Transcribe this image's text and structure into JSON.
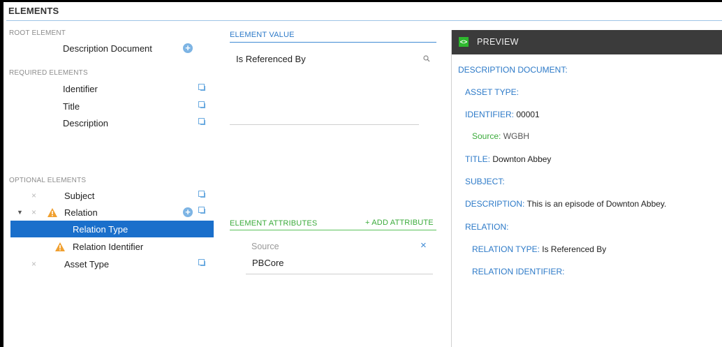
{
  "panel_title": "ELEMENTS",
  "root": {
    "heading": "ROOT ELEMENT",
    "item": "Description Document"
  },
  "required": {
    "heading": "REQUIRED ELEMENTS",
    "items": [
      "Identifier",
      "Title",
      "Description"
    ]
  },
  "optional": {
    "heading": "OPTIONAL ELEMENTS",
    "items": [
      "Subject",
      "Relation",
      "Relation Type",
      "Relation Identifier",
      "Asset Type"
    ],
    "remove_glyph": "×",
    "expand_glyph": "▼",
    "selected": "Relation Type"
  },
  "element_value": {
    "heading": "ELEMENT VALUE",
    "value": "Is Referenced By"
  },
  "attributes": {
    "heading": "ELEMENT ATTRIBUTES",
    "add_label": "+ ADD ATTRIBUTE",
    "items": [
      {
        "name": "Source",
        "value": "PBCore"
      }
    ]
  },
  "preview": {
    "title": "PREVIEW",
    "icon": "<>",
    "lines": [
      {
        "key": "DESCRIPTION DOCUMENT:",
        "value": ""
      },
      {
        "key": "ASSET TYPE:",
        "value": ""
      },
      {
        "key": "IDENTIFIER:",
        "value": "00001"
      },
      {
        "key": "Source:",
        "value": "WGBH"
      },
      {
        "key": "TITLE:",
        "value": "Downton Abbey"
      },
      {
        "key": "SUBJECT:",
        "value": ""
      },
      {
        "key": "DESCRIPTION:",
        "value": "This is an episode of Downton Abbey."
      },
      {
        "key": "RELATION:",
        "value": ""
      },
      {
        "key": "RELATION TYPE:",
        "value": "Is Referenced By"
      },
      {
        "key": "RELATION IDENTIFIER:",
        "value": ""
      }
    ]
  },
  "colors": {
    "accent_blue": "#1a6fcb",
    "link_blue": "#2d7ac8",
    "green": "#3bab3b",
    "warning": "#f0a030",
    "preview_bar": "#3b3b3b"
  }
}
